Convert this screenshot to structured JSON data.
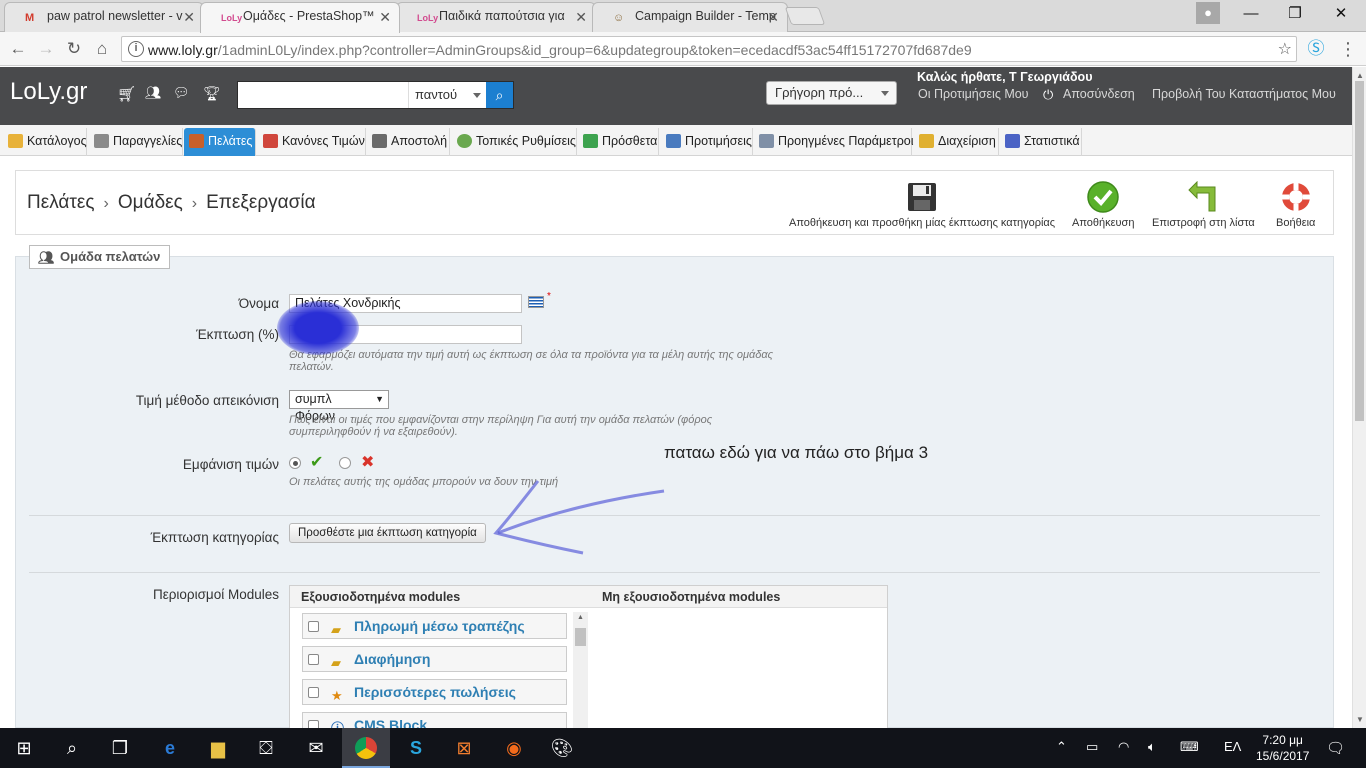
{
  "browser": {
    "tabs": [
      {
        "title": "paw patrol newsletter - v",
        "favicon": "gmail-icon",
        "active": false
      },
      {
        "title": "Ομάδες - PrestaShop™",
        "favicon": "loly-icon",
        "active": true
      },
      {
        "title": "Παιδικά παπούτσια για",
        "favicon": "loly-icon",
        "active": false
      },
      {
        "title": "Campaign Builder - Temp",
        "favicon": "mailchimp-icon",
        "active": false
      }
    ],
    "url_domain": "www.loly.gr",
    "url_path": "/1adminL0Ly/index.php?controller=AdminGroups&id_group=6&updategroup&token=ecedacdf53ac54ff15172707fd687de9"
  },
  "header": {
    "logo": "LoLy.gr",
    "search_placeholder": "",
    "search_scope": "παντού",
    "quick_access": "Γρήγορη πρό...",
    "welcome": "Καλώς ήρθατε, Τ Γεωργιάδου",
    "links": {
      "prefs": "Οι Προτιμήσεις Μου",
      "logout": "Αποσύνδεση",
      "view_shop": "Προβολή Του Καταστήματος Μου"
    }
  },
  "menu": [
    {
      "label": "Κατάλογος",
      "color": "#e8b23a"
    },
    {
      "label": "Παραγγελίες",
      "color": "#8a8a8a"
    },
    {
      "label": "Πελάτες",
      "color": "#c8602a",
      "active": true
    },
    {
      "label": "Κανόνες Τιμών",
      "color": "#d0463c"
    },
    {
      "label": "Αποστολή",
      "color": "#6a6a6a"
    },
    {
      "label": "Τοπικές Ρυθμίσεις",
      "color": "#6aa84f"
    },
    {
      "label": "Πρόσθετα",
      "color": "#3da34f"
    },
    {
      "label": "Προτιμήσεις",
      "color": "#4a7bbf"
    },
    {
      "label": "Προηγμένες Παράμετροι",
      "color": "#7f8fa6"
    },
    {
      "label": "Διαχείριση",
      "color": "#e0b030"
    },
    {
      "label": "Στατιστικά",
      "color": "#4b63c5"
    }
  ],
  "breadcrumb": {
    "a": "Πελάτες",
    "b": "Ομάδες",
    "c": "Επεξεργασία"
  },
  "toolbar": {
    "save_add": "Αποθήκευση και προσθήκη μίας έκπτωσης κατηγορίας",
    "save": "Αποθήκευση",
    "back": "Επιστροφή στη λίστα",
    "help": "Βοήθεια"
  },
  "form": {
    "legend": "Ομάδα πελατών",
    "name_label": "Όνομα",
    "name_value": "Πελάτες Χονδρικής",
    "required_mark": "*",
    "discount_label": "Έκπτωση (%)",
    "discount_value": "",
    "discount_hint": "Θα εφαρμόζει αυτόματα την τιμή αυτή ως έκπτωση σε όλα τα προϊόντα για τα μέλη αυτής της ομάδας πελατών.",
    "price_label": "Τιμή μέθοδο απεικόνιση",
    "price_value": "συμπλ Φόρων",
    "price_hint": "Πώς είναι οι τιμές που εμφανίζονται στην περίληψη Για αυτή την ομάδα πελατών (φόρος συμπεριληφθούν ή να εξαιρεθούν).",
    "show_prices_label": "Εμφάνιση τιμών",
    "show_prices_value": "yes",
    "show_prices_hint": "Οι πελάτες αυτής της ομάδας μπορούν να δουν την τιμή",
    "cat_discount_label": "Έκπτωση κατηγορίας",
    "cat_discount_button": "Προσθέστε μια έκπτωση κατηγορία",
    "modules_label": "Περιορισμοί Modules",
    "authorized_header": "Εξουσιοδοτημένα modules",
    "unauthorized_header": "Μη εξουσιοδοτημένα modules",
    "modules": [
      {
        "name": "Πληρωμή μέσω τραπέζης",
        "icon": "coins-icon"
      },
      {
        "name": "Διαφήμηση",
        "icon": "coins-icon"
      },
      {
        "name": "Περισσότερες πωλήσεις",
        "icon": "star-icon"
      },
      {
        "name": "CMS Block",
        "icon": "info-icon"
      }
    ]
  },
  "annotation": "παταω εδώ για να πάω στο βήμα 3",
  "taskbar": {
    "lang": "ΕΛ",
    "time": "7:20 μμ",
    "date": "15/6/2017"
  }
}
